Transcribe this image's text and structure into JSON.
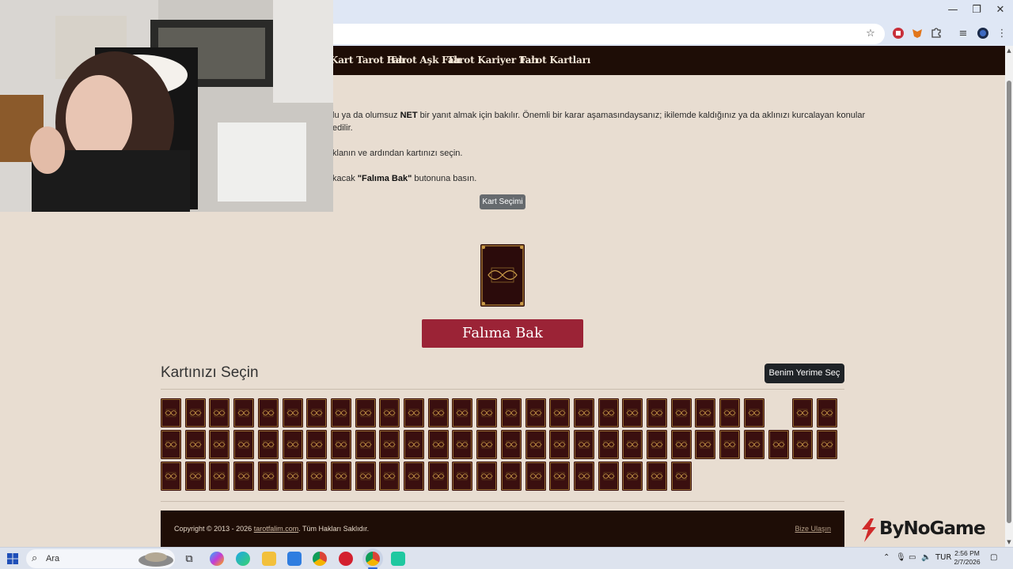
{
  "nav": {
    "links": [
      "Kart Tarot Falı",
      "Tarot Aşk Falı",
      "Tarot Kariyer Falı",
      "Tarot Kartları"
    ]
  },
  "intro": {
    "line1_prefix": "lu ya da olumsuz ",
    "line1_bold": "NET",
    "line1_suffix": " bir yanıt almak için bakılır. Önemli bir karar aşamasındaysanız; ikilemde kaldığınız ya da aklınızı kurcalayan konular",
    "line2": "edilir.",
    "line3": "klanın ve ardından kartınızı seçin.",
    "line4_prefix": "kacak ",
    "line4_bold": "\"Falıma Bak\"",
    "line4_suffix": " butonuna basın."
  },
  "buttons": {
    "kart_secimi": "Kart Seçimi",
    "falima_bak": "Falıma Bak",
    "benim_yerime": "Benim Yerime Seç"
  },
  "card_picker": {
    "title": "Kartınızı Seçin",
    "row_counts": [
      28,
      28,
      22
    ],
    "missing_slots": [
      {
        "row": 0,
        "col": 25
      }
    ]
  },
  "footer": {
    "copyright_prefix": "Copyright © 2013 - 2026 ",
    "copyright_link": "tarotfalim.com",
    "copyright_suffix": ". Tüm Hakları Saklıdır.",
    "contact": "Bize Ulaşın"
  },
  "overlay": {
    "brand": "ByNoGame"
  },
  "taskbar": {
    "search_placeholder": "Ara",
    "language": "TUR",
    "time": "2:56 PM",
    "date": "2/7/2026"
  },
  "colors": {
    "nav_bg": "#1e0d06",
    "page_bg": "#e8ddd1",
    "card_back": "#3a0f0f",
    "primary_button": "#9b2336",
    "dark_button": "#1f2327"
  },
  "icons": {
    "star": "bookmark-star-icon",
    "extensions": "puzzle-icon",
    "menu": "kebab-menu-icon"
  }
}
